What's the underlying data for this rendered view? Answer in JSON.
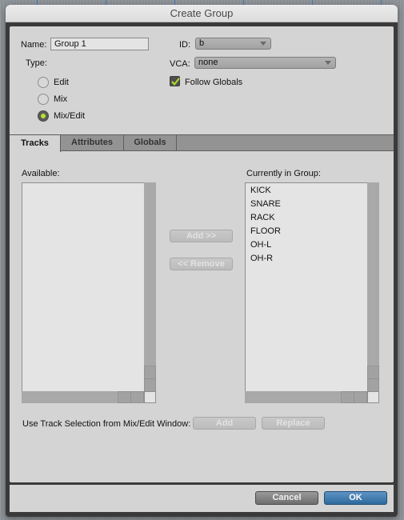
{
  "window": {
    "title": "Create Group"
  },
  "form": {
    "name_label": "Name:",
    "name_value": "Group 1",
    "type_label": "Type:",
    "type_options": [
      {
        "label": "Edit",
        "selected": false
      },
      {
        "label": "Mix",
        "selected": false
      },
      {
        "label": "Mix/Edit",
        "selected": true
      }
    ],
    "id_label": "ID:",
    "id_value": "b",
    "vca_label": "VCA:",
    "vca_value": "none",
    "follow_globals_label": "Follow Globals",
    "follow_globals_checked": true
  },
  "tabs": [
    {
      "label": "Tracks",
      "active": true
    },
    {
      "label": "Attributes",
      "active": false
    },
    {
      "label": "Globals",
      "active": false
    }
  ],
  "tracks": {
    "available_label": "Available:",
    "available_items": [],
    "in_group_label": "Currently in Group:",
    "in_group_items": [
      "KICK",
      "SNARE",
      "RACK",
      "FLOOR",
      "OH-L",
      "OH-R"
    ],
    "add_button": "Add >>",
    "remove_button": "<< Remove",
    "use_selection_label": "Use Track Selection from Mix/Edit Window:",
    "selection_add_button": "Add",
    "selection_replace_button": "Replace"
  },
  "footer": {
    "cancel_label": "Cancel",
    "ok_label": "OK"
  },
  "colors": {
    "radio_selected": "#b4e032",
    "checkbox_check": "#a8d92c",
    "ok_button": "#3c77aa",
    "accent_line": "#3f7fbf"
  }
}
